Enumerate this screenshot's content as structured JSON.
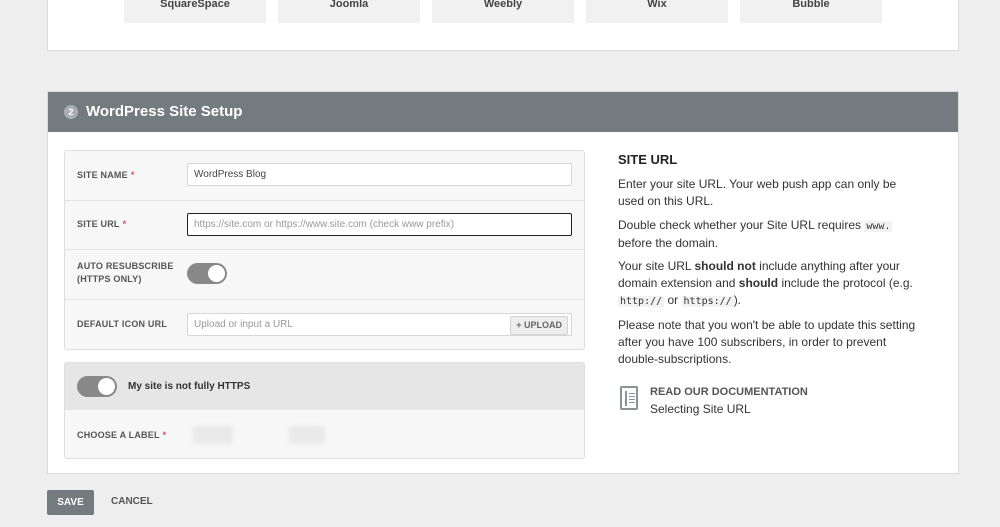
{
  "platforms": [
    "SquareSpace",
    "Joomla",
    "Weebly",
    "Wix",
    "Bubble"
  ],
  "section": {
    "step": "2",
    "title": "WordPress Site Setup"
  },
  "form": {
    "site_name": {
      "label": "SITE NAME",
      "required": "*",
      "value": "WordPress Blog"
    },
    "site_url": {
      "label": "SITE URL",
      "required": "*",
      "placeholder": "https://site.com or https://www.site.com (check www prefix)"
    },
    "auto_resubscribe": {
      "label_line1": "AUTO RESUBSCRIBE",
      "label_line2": "(HTTPS ONLY)",
      "state": "on"
    },
    "default_icon": {
      "label": "DEFAULT ICON URL",
      "placeholder": "Upload or input a URL",
      "upload_label": "UPLOAD"
    }
  },
  "https": {
    "toggle_label": "My site is not fully HTTPS",
    "toggle_state": "on",
    "choose_label": "CHOOSE A LABEL",
    "required": "*"
  },
  "help": {
    "title": "SITE URL",
    "p1": "Enter your site URL. Your web push app can only be used on this URL.",
    "p2_before": "Double check whether your Site URL requires",
    "p2_code": "www.",
    "p2_after": "before the domain.",
    "p3_a": "Your site URL",
    "p3_b": "should not",
    "p3_c": "include anything after your domain extension and",
    "p3_d": "should",
    "p3_e": "include the protocol (e.g.",
    "p3_code1": "http://",
    "p3_or": "or",
    "p3_code2": "https://",
    "p3_end": ").",
    "p4": "Please note that you won't be able to update this setting after you have 100 subscribers, in order to prevent double-subscriptions.",
    "doc_heading": "READ OUR DOCUMENTATION",
    "doc_link": "Selecting Site URL"
  },
  "actions": {
    "save": "SAVE",
    "cancel": "CANCEL"
  },
  "colors": {
    "header": "#737b7f",
    "toggle": "#888888",
    "required": "#d9534f"
  }
}
